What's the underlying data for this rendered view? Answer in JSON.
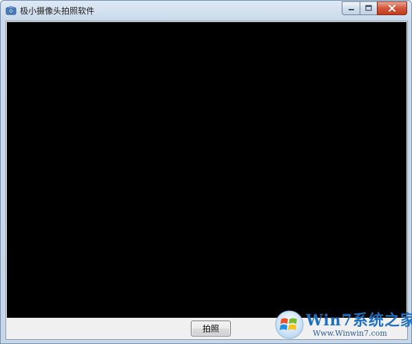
{
  "window": {
    "title": "极小摄像头拍照软件"
  },
  "caption_buttons": {
    "minimize_icon": "minimize-icon",
    "maximize_icon": "maximize-icon",
    "close_icon": "close-icon"
  },
  "bottom_bar": {
    "capture_label": "拍照"
  },
  "watermark": {
    "main_text": "Win7系统之家",
    "url_text": "Www.Winwin7.com",
    "accent": "#1f6fbf"
  },
  "colors": {
    "video_background": "#000000",
    "window_frame": "#c7d6e8"
  }
}
